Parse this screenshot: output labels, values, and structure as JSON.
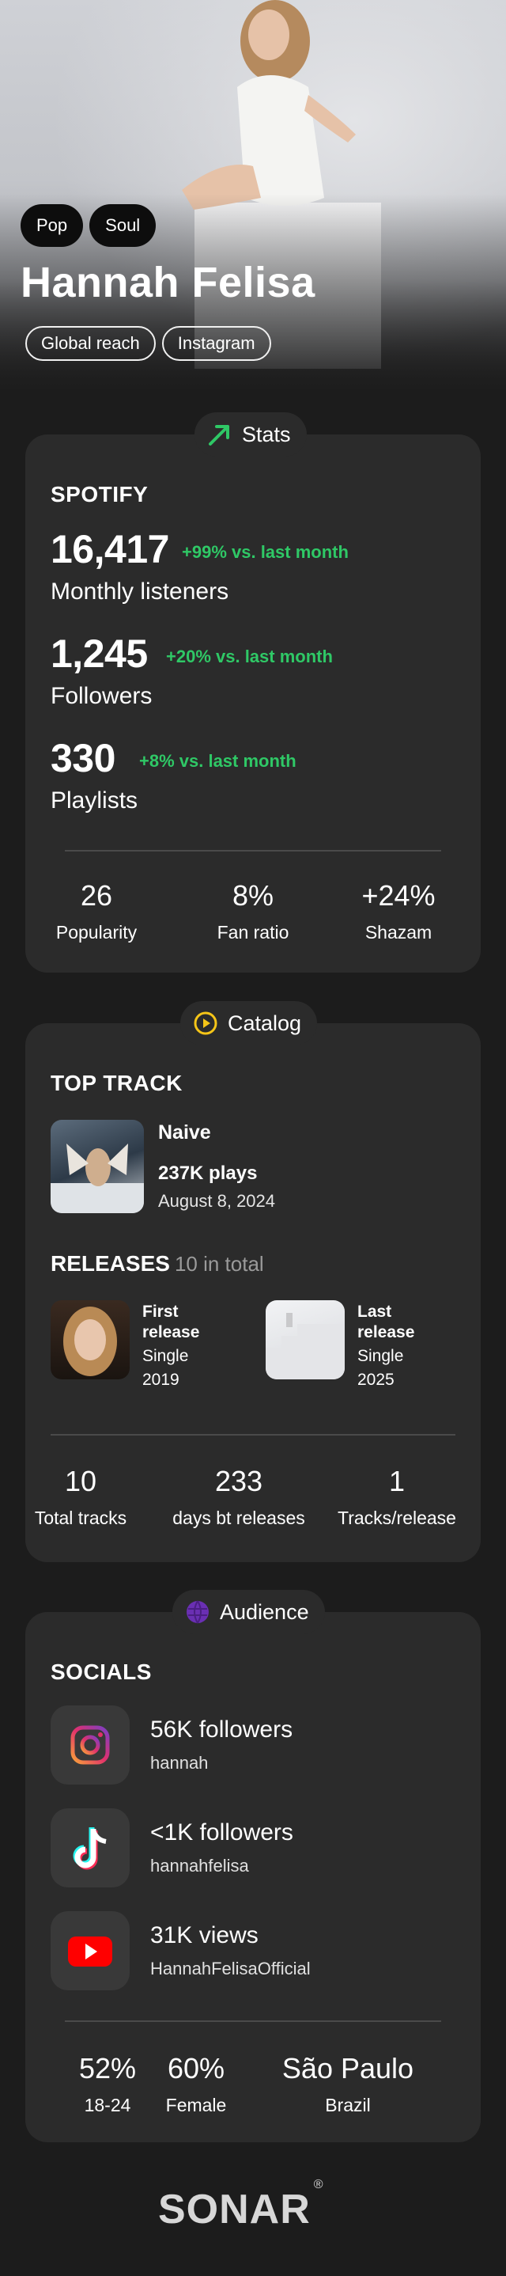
{
  "artist": {
    "name": "Hannah Felisa",
    "genres": [
      "Pop",
      "Soul"
    ],
    "chips": [
      "Global reach",
      "Instagram"
    ]
  },
  "stats": {
    "label": "Stats",
    "section": "SPOTIFY",
    "metrics": [
      {
        "value": "16,417",
        "delta": "+99% vs. last month",
        "label": "Monthly listeners"
      },
      {
        "value": "1,245",
        "delta": "+20% vs. last month",
        "label": "Followers"
      },
      {
        "value": "330",
        "delta": "+8% vs. last month",
        "label": "Playlists"
      }
    ],
    "sub": [
      {
        "value": "26",
        "label": "Popularity"
      },
      {
        "value": "8%",
        "label": "Fan ratio"
      },
      {
        "value": "+24%",
        "label": "Shazam"
      }
    ]
  },
  "catalog": {
    "label": "Catalog",
    "top_track_heading": "TOP TRACK",
    "top_track": {
      "name": "Naive",
      "plays": "237K plays",
      "date": "August 8, 2024"
    },
    "releases_heading": "RELEASES",
    "releases_total": "10 in total",
    "first_release": {
      "title": "First release",
      "type": "Single",
      "year": "2019"
    },
    "last_release": {
      "title": "Last release",
      "type": "Single",
      "year": "2025"
    },
    "sub": [
      {
        "value": "10",
        "label": "Total tracks"
      },
      {
        "value": "233",
        "label": "days bt releases"
      },
      {
        "value": "1",
        "label": "Tracks/release"
      }
    ]
  },
  "audience": {
    "label": "Audience",
    "socials_heading": "SOCIALS",
    "socials": [
      {
        "icon": "instagram-icon",
        "count": "56K followers",
        "handle": "hannah"
      },
      {
        "icon": "tiktok-icon",
        "count": "<1K followers",
        "handle": "hannahfelisa"
      },
      {
        "icon": "youtube-icon",
        "count": "31K views",
        "handle": "HannahFelisaOfficial"
      }
    ],
    "sub": [
      {
        "value": "52%",
        "label": "18-24"
      },
      {
        "value": "60%",
        "label": "Female"
      },
      {
        "value": "São Paulo",
        "label": "Brazil"
      }
    ]
  },
  "brand": {
    "logo": "SONAR",
    "mark": "®"
  },
  "colors": {
    "background": "#1c1c1c",
    "card": "#2b2b2b",
    "positive": "#2fc866",
    "accent_stats": "#2fc866",
    "accent_catalog": "#f5c518",
    "accent_audience": "#6a2fb3"
  }
}
